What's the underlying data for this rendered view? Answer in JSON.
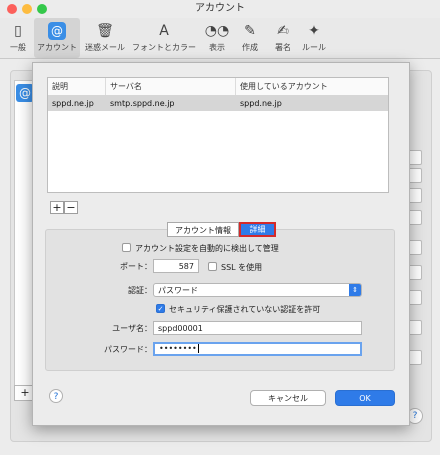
{
  "window": {
    "title": "アカウント"
  },
  "toolbar": {
    "items": [
      {
        "label": "一般",
        "icon": "switch-icon"
      },
      {
        "label": "アカウント",
        "icon": "at-icon"
      },
      {
        "label": "迷惑メール",
        "icon": "trash-icon"
      },
      {
        "label": "フォントとカラー",
        "icon": "font-icon"
      },
      {
        "label": "表示",
        "icon": "glasses-icon"
      },
      {
        "label": "作成",
        "icon": "compose-icon"
      },
      {
        "label": "署名",
        "icon": "signature-icon"
      },
      {
        "label": "ルール",
        "icon": "rules-icon"
      }
    ]
  },
  "servers_table": {
    "headers": [
      "説明",
      "サーバ名",
      "使用しているアカウント"
    ],
    "rows": [
      [
        "sppd.ne.jp",
        "smtp.sppd.ne.jp",
        "sppd.ne.jp"
      ]
    ]
  },
  "list_controls": {
    "add": "+",
    "remove": "−"
  },
  "tabs": {
    "account_info": "アカウント情報",
    "advanced": "詳細"
  },
  "details": {
    "auto_detect_label": "アカウント設定を自動的に検出して管理",
    "port_label": "ポート：",
    "port_value": "587",
    "ssl_label": "SSL を使用",
    "auth_label": "認証：",
    "auth_value": "パスワード",
    "insecure_auth_label": "セキュリティ保護されていない認証を許可",
    "username_label": "ユーザ名：",
    "username_value": "sppd00001",
    "password_label": "パスワード：",
    "password_value": "••••••••"
  },
  "buttons": {
    "help": "?",
    "cancel": "キャンセル",
    "ok": "OK"
  },
  "colors": {
    "accent": "#2f7be8",
    "highlight_border": "#d42a2a",
    "selected_row": "#d6d6d6"
  }
}
